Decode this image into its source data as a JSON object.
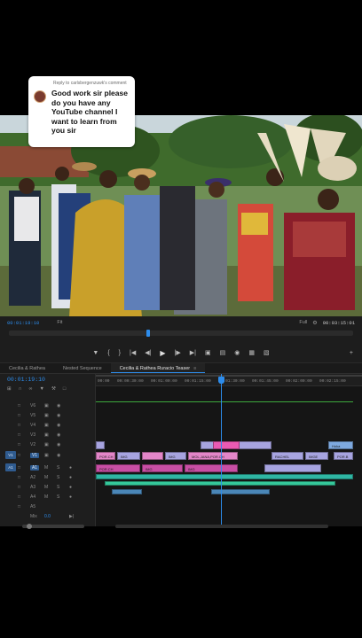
{
  "comment": {
    "reply_header": "Reply to carlsbergenzuwk's comment",
    "text": "Good work sir please do you have any YouTube channel I want to learn from you sir"
  },
  "monitor": {
    "timecode_current": "00:01:19:10",
    "fit": "Fit",
    "full": "Full",
    "timecode_total": "00:03:15:01",
    "transport": [
      "mark-in-icon",
      "mark-out-icon",
      "go-to-in-icon",
      "step-back-icon",
      "play-icon",
      "step-forward-icon",
      "go-to-out-icon",
      "lift-icon",
      "extract-icon",
      "export-frame-icon",
      "compare-icon",
      "vr-icon",
      "settings-icon"
    ]
  },
  "timeline": {
    "tabs": [
      "Cecilia & Rathea",
      "Nested Sequence",
      "Cecilia & Rathea Ruracio Teaser"
    ],
    "active_tab": 2,
    "timecode": "00:01:19:10",
    "ruler": [
      "00:00",
      "00:00:30:00",
      "00:01:00:00",
      "00:01:15:00",
      "00:01:30:00",
      "00:01:45:00",
      "00:02:00:00",
      "00:02:15:00"
    ],
    "tracks": [
      {
        "name": "V6"
      },
      {
        "name": "V5"
      },
      {
        "name": "V4"
      },
      {
        "name": "V3"
      },
      {
        "name": "V2"
      },
      {
        "name": "V1",
        "source": "V1"
      },
      {
        "name": "A1",
        "source": "A1"
      },
      {
        "name": "A2"
      },
      {
        "name": "A3"
      },
      {
        "name": "A4"
      },
      {
        "name": "A5"
      },
      {
        "name": "Mix",
        "value": "0.0"
      }
    ],
    "clips_v2": [
      "Hoka"
    ],
    "clips_v1": [
      "POR.CH",
      "IMG",
      "IMG",
      "MOL,JANA,POR.CH",
      "RACHEL",
      "IMGE",
      "POR.B"
    ],
    "clips_a1": [
      "POR.CH",
      "IMG",
      "IMG"
    ],
    "accent": "#2d8ceb"
  }
}
